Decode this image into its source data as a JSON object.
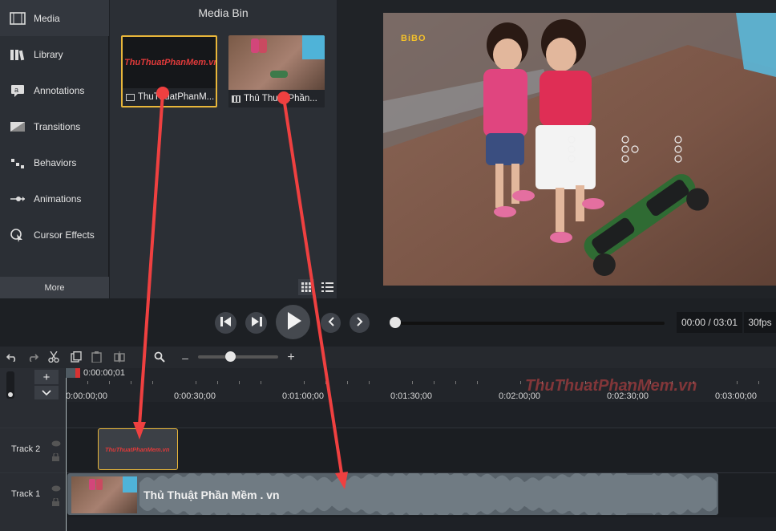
{
  "tools": {
    "items": [
      {
        "label": "Media",
        "icon": "media-icon"
      },
      {
        "label": "Library",
        "icon": "library-icon"
      },
      {
        "label": "Annotations",
        "icon": "annotations-icon"
      },
      {
        "label": "Transitions",
        "icon": "transitions-icon"
      },
      {
        "label": "Behaviors",
        "icon": "behaviors-icon"
      },
      {
        "label": "Animations",
        "icon": "animations-icon"
      },
      {
        "label": "Cursor Effects",
        "icon": "cursor-effects-icon"
      }
    ],
    "more_label": "More",
    "add_label": "+"
  },
  "media_bin": {
    "title": "Media Bin",
    "items": [
      {
        "caption": "ThuThuatPhanM...",
        "logo": "ThuThuatPhanMem.vn",
        "type": "image-icon"
      },
      {
        "caption": "Thủ Thuật Phần...",
        "type": "video-icon"
      }
    ]
  },
  "preview": {
    "overlay_logo": "BiBO"
  },
  "playback": {
    "time": "00:00 / 03:01",
    "fps": "30fps",
    "progress": 0
  },
  "timeline": {
    "playhead_time": "0:00:00;01",
    "ticks": [
      "0:00:00;00",
      "0:00:30;00",
      "0:01:00;00",
      "0:01:30;00",
      "0:02:00;00",
      "0:02:30;00",
      "0:03:00;00"
    ],
    "tracks": [
      {
        "label": "Track 2"
      },
      {
        "label": "Track 1"
      }
    ],
    "image_clip_logo": "ThuThuatPhanMem.vn",
    "video_clip_title": "Thủ Thuật Phần Mềm . vn",
    "zoom_level": 0.4,
    "zoom_minus": "–",
    "zoom_plus": "+"
  },
  "watermark": "ThuThuatPhanMem.vn",
  "colors": {
    "accent": "#e8b63a",
    "arrow": "#ef4040"
  }
}
